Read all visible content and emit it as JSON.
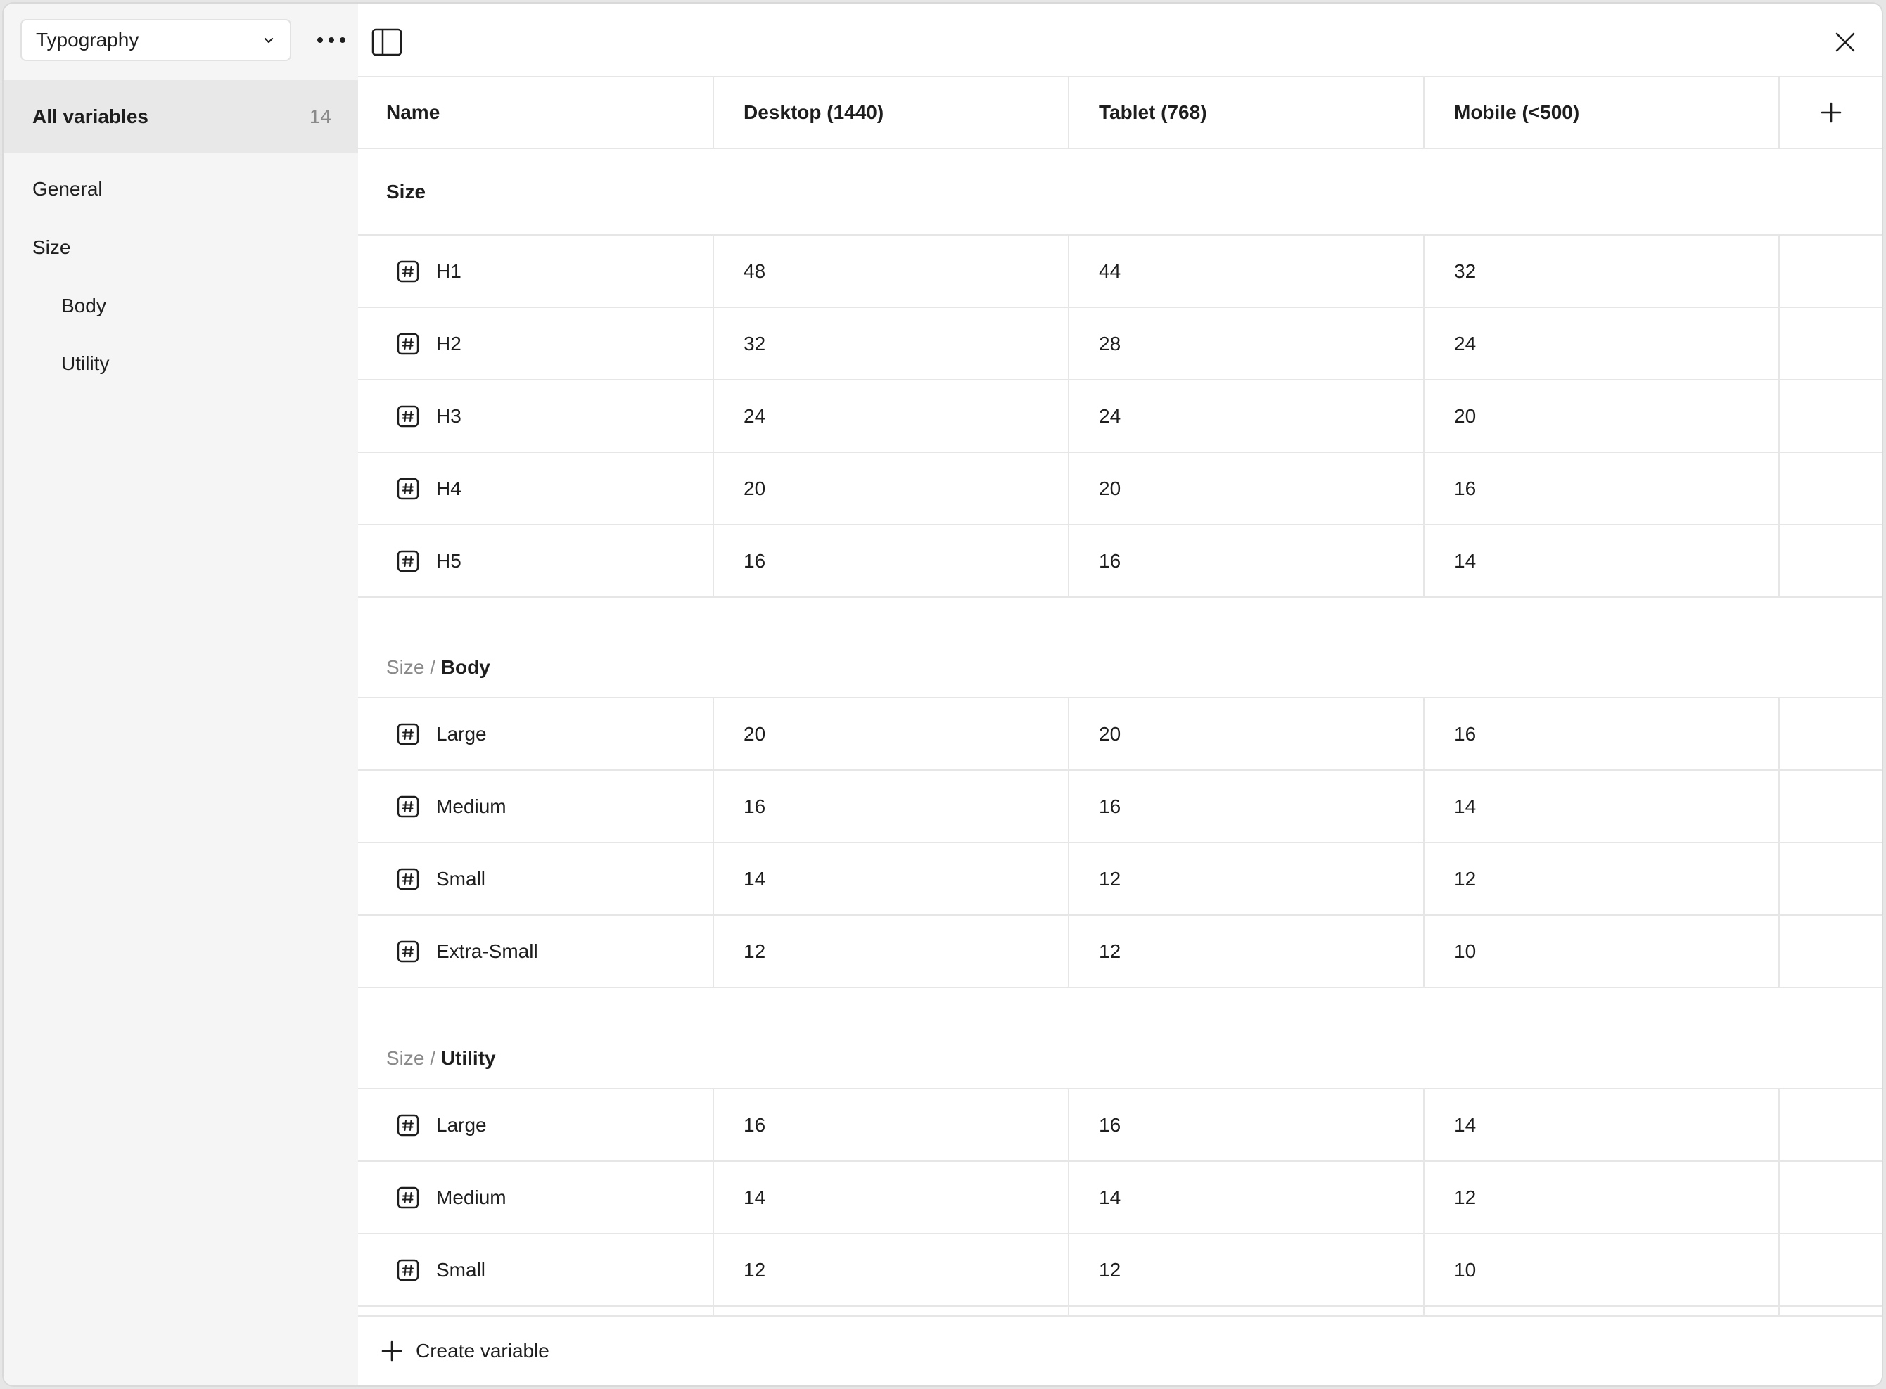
{
  "sidebar": {
    "collection": "Typography",
    "all_variables": {
      "label": "All variables",
      "count": "14"
    },
    "items": [
      {
        "label": "General"
      },
      {
        "label": "Size"
      },
      {
        "label": "Body"
      },
      {
        "label": "Utility"
      }
    ]
  },
  "table": {
    "columns": [
      "Name",
      "Desktop (1440)",
      "Tablet (768)",
      "Mobile (<500)"
    ],
    "groups": [
      {
        "crumb": "",
        "name": "Size",
        "rows": [
          {
            "name": "H1",
            "values": [
              "48",
              "44",
              "32"
            ]
          },
          {
            "name": "H2",
            "values": [
              "32",
              "28",
              "24"
            ]
          },
          {
            "name": "H3",
            "values": [
              "24",
              "24",
              "20"
            ]
          },
          {
            "name": "H4",
            "values": [
              "20",
              "20",
              "16"
            ]
          },
          {
            "name": "H5",
            "values": [
              "16",
              "16",
              "14"
            ]
          }
        ]
      },
      {
        "crumb": "Size / ",
        "name": "Body",
        "rows": [
          {
            "name": "Large",
            "values": [
              "20",
              "20",
              "16"
            ]
          },
          {
            "name": "Medium",
            "values": [
              "16",
              "16",
              "14"
            ]
          },
          {
            "name": "Small",
            "values": [
              "14",
              "12",
              "12"
            ]
          },
          {
            "name": "Extra-Small",
            "values": [
              "12",
              "12",
              "10"
            ]
          }
        ]
      },
      {
        "crumb": "Size / ",
        "name": "Utility",
        "rows": [
          {
            "name": "Large",
            "values": [
              "16",
              "16",
              "14"
            ]
          },
          {
            "name": "Medium",
            "values": [
              "14",
              "14",
              "12"
            ]
          },
          {
            "name": "Small",
            "values": [
              "12",
              "12",
              "10"
            ]
          }
        ]
      }
    ]
  },
  "footer": {
    "create_label": "Create variable"
  }
}
